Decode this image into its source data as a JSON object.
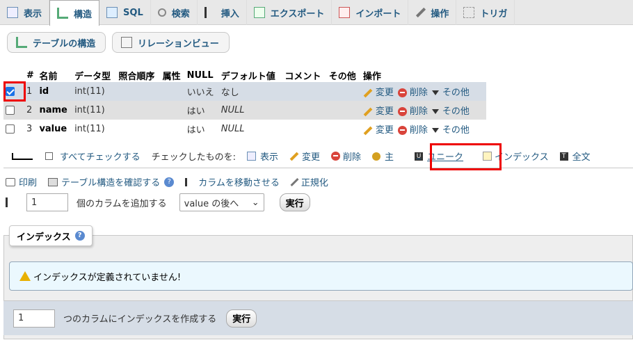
{
  "tabs": [
    "表示",
    "構造",
    "SQL",
    "検索",
    "挿入",
    "エクスポート",
    "インポート",
    "操作",
    "トリガ"
  ],
  "subtabs": [
    "テーブルの構造",
    "リレーションビュー"
  ],
  "table": {
    "headers": [
      "#",
      "名前",
      "データ型",
      "照合順序",
      "属性",
      "NULL",
      "デフォルト値",
      "コメント",
      "その他",
      "操作"
    ],
    "rows": [
      {
        "num": "1",
        "name": "id",
        "type": "int(11)",
        "null": "いいえ",
        "default": "なし"
      },
      {
        "num": "2",
        "name": "name",
        "type": "int(11)",
        "null": "はい",
        "default": "NULL"
      },
      {
        "num": "3",
        "name": "value",
        "type": "int(11)",
        "null": "はい",
        "default": "NULL"
      }
    ],
    "actions": {
      "edit": "変更",
      "delete": "削除",
      "more": "その他"
    }
  },
  "bulk": {
    "check_all": "すべてチェックする",
    "with_selected": "チェックしたものを:",
    "browse": "表示",
    "change": "変更",
    "drop": "削除",
    "primary": "主",
    "unique": "ユニーク",
    "index": "インデックス",
    "fulltext": "全文"
  },
  "tools": {
    "print": "印刷",
    "propose": "テーブル構造を確認する",
    "move": "カラムを移動させる",
    "normalize": "正規化"
  },
  "add_columns": {
    "count": "1",
    "label": "個のカラムを追加する",
    "position": "value の後へ",
    "go": "実行"
  },
  "indexes": {
    "legend": "インデックス",
    "notice": "インデックスが定義されていません!",
    "create_count": "1",
    "create_label": "つのカラムにインデックスを作成する",
    "go": "実行"
  },
  "colors": {
    "link": "#235a81",
    "highlight": "#e00000"
  }
}
